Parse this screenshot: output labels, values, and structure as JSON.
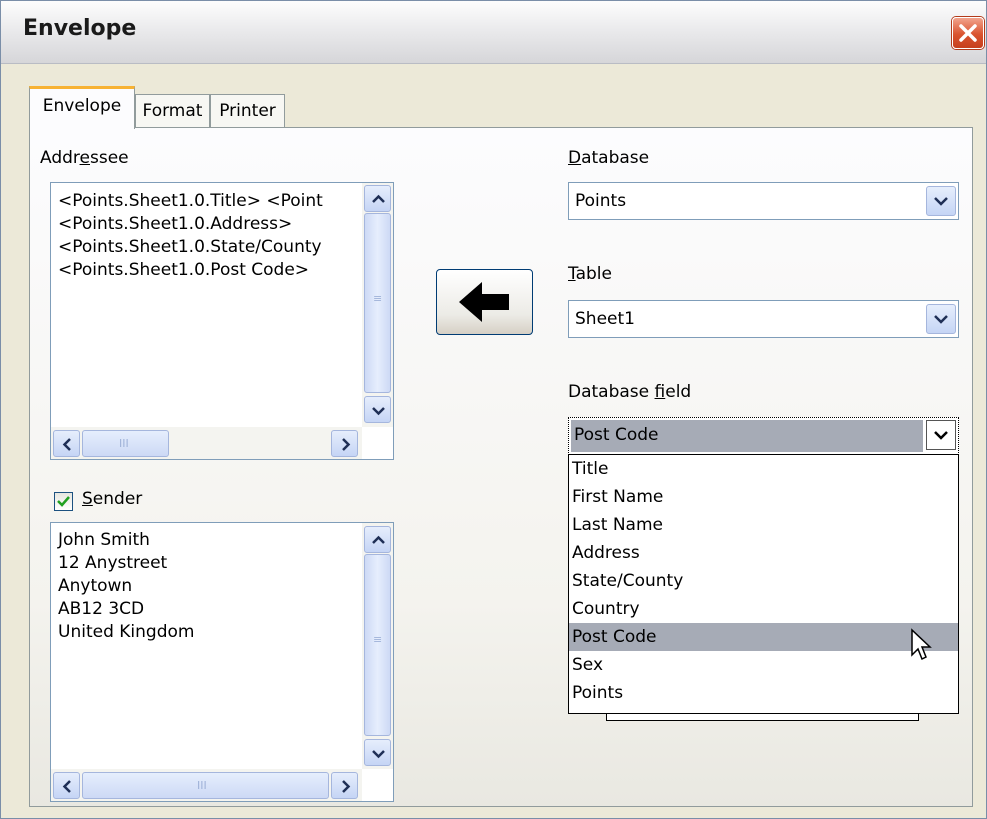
{
  "window": {
    "title": "Envelope"
  },
  "tabs": [
    {
      "label": "Envelope"
    },
    {
      "label": "Format"
    },
    {
      "label": "Printer"
    }
  ],
  "addressee": {
    "label_pre": "Addr",
    "label_key": "e",
    "label_post": "ssee",
    "lines": [
      "<Points.Sheet1.0.Title> <Point",
      "<Points.Sheet1.0.Address>",
      "<Points.Sheet1.0.State/County",
      "<Points.Sheet1.0.Post Code>"
    ]
  },
  "sender": {
    "label_key": "S",
    "label_post": "ender",
    "checked": true,
    "lines": [
      "John Smith",
      "12 Anystreet",
      "Anytown",
      "AB12 3CD",
      "United Kingdom"
    ]
  },
  "database": {
    "label_key": "D",
    "label_post": "atabase",
    "value": "Points"
  },
  "table": {
    "label_key": "T",
    "label_post": "able",
    "value": "Sheet1"
  },
  "database_field": {
    "label_pre": "Database ",
    "label_key": "f",
    "label_post": "ield",
    "value": "Post Code",
    "options": [
      "Title",
      "First Name",
      "Last Name",
      "Address",
      "State/County",
      "Country",
      "Post Code",
      "Sex",
      "Points"
    ],
    "highlighted": "Post Code"
  },
  "icons": {
    "insert": "arrow-left-icon",
    "close": "close-icon",
    "check": "checkmark-icon"
  },
  "colors": {
    "active_tab_accent": "#f7b234",
    "selection": "#a6abb6",
    "close_button": "#d9532f"
  }
}
